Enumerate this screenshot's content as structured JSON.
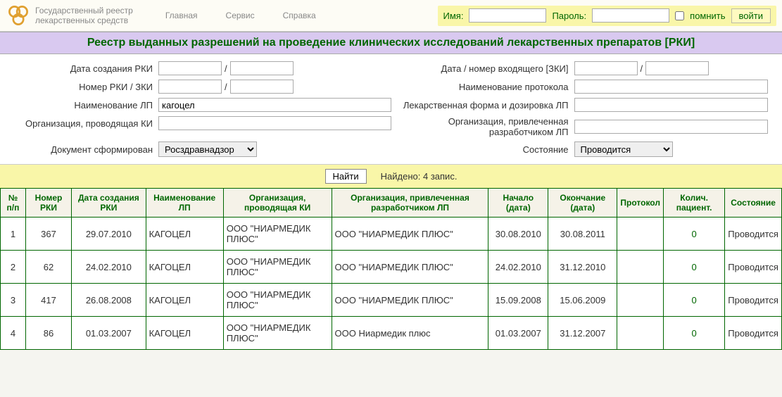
{
  "header": {
    "logo_line1": "Государственный реестр",
    "logo_line2": "лекарственных средств",
    "nav": [
      "Главная",
      "Сервис",
      "Справка"
    ],
    "login_name_label": "Имя:",
    "login_pass_label": "Пароль:",
    "remember_label": "помнить",
    "login_btn": "войти"
  },
  "title": "Реестр выданных разрешений на проведение клинических исследований лекарственных препаратов [РКИ]",
  "form": {
    "date_rki_label": "Дата создания РКИ",
    "num_rki_label": "Номер РКИ / ЗКИ",
    "name_lp_label": "Наименование ЛП",
    "name_lp_value": "кагоцел",
    "org_ki_label": "Организация, проводящая КИ",
    "doc_label": "Документ сформирован",
    "doc_value": "Росздравнадзор",
    "date_in_label": "Дата / номер входящего [ЗКИ]",
    "protocol_label": "Наименование протокола",
    "dose_label": "Лекарственная форма и дозировка ЛП",
    "org_dev_label": "Организация, привлеченная разработчиком ЛП",
    "state_label": "Состояние",
    "state_value": "Проводится",
    "slash": "/"
  },
  "search": {
    "find_btn": "Найти",
    "found_text": "Найдено: 4 запис."
  },
  "table": {
    "headers": [
      "№ п/п",
      "Номер РКИ",
      "Дата создания РКИ",
      "Наименование ЛП",
      "Организация, проводящая КИ",
      "Организация, привлеченная разработчиком ЛП",
      "Начало (дата)",
      "Окончание (дата)",
      "Протокол",
      "Колич. пациент.",
      "Состояние"
    ],
    "rows": [
      {
        "n": "1",
        "num": "367",
        "date": "29.07.2010",
        "name": "КАГОЦЕЛ",
        "org_ki": "ООО \"НИАРМЕДИК ПЛЮС\"",
        "org_dev": "ООО \"НИАРМЕДИК ПЛЮС\"",
        "start": "30.08.2010",
        "end": "30.08.2011",
        "protocol": "",
        "patients": "0",
        "state": "Проводится"
      },
      {
        "n": "2",
        "num": "62",
        "date": "24.02.2010",
        "name": "КАГОЦЕЛ",
        "org_ki": "ООО \"НИАРМЕДИК ПЛЮС\"",
        "org_dev": "ООО \"НИАРМЕДИК ПЛЮС\"",
        "start": "24.02.2010",
        "end": "31.12.2010",
        "protocol": "",
        "patients": "0",
        "state": "Проводится"
      },
      {
        "n": "3",
        "num": "417",
        "date": "26.08.2008",
        "name": "КАГОЦЕЛ",
        "org_ki": "ООО \"НИАРМЕДИК ПЛЮС\"",
        "org_dev": "ООО \"НИАРМЕДИК ПЛЮС\"",
        "start": "15.09.2008",
        "end": "15.06.2009",
        "protocol": "",
        "patients": "0",
        "state": "Проводится"
      },
      {
        "n": "4",
        "num": "86",
        "date": "01.03.2007",
        "name": "КАГОЦЕЛ",
        "org_ki": "ООО \"НИАРМЕДИК ПЛЮС\"",
        "org_dev": "ООО Ниармедик плюс",
        "start": "01.03.2007",
        "end": "31.12.2007",
        "protocol": "",
        "patients": "0",
        "state": "Проводится"
      }
    ]
  }
}
